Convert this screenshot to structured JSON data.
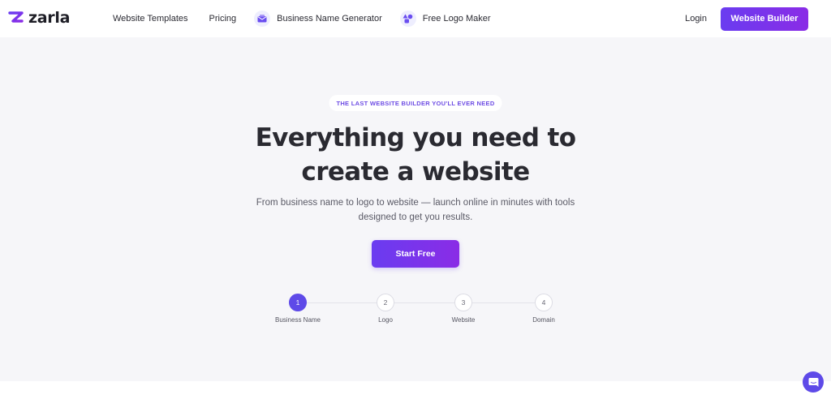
{
  "brand": {
    "name": "zarla",
    "color": "#5e4ae8"
  },
  "nav": {
    "links": [
      {
        "label": "Website Templates"
      },
      {
        "label": "Pricing"
      },
      {
        "label": "Business Name Generator",
        "icon": "envelope-icon"
      },
      {
        "label": "Free Logo Maker",
        "icon": "shapes-icon"
      }
    ],
    "login": "Login",
    "cta": "Website Builder"
  },
  "hero": {
    "badge": "THE LAST WEBSITE BUILDER YOU'LL EVER NEED",
    "headline_line1": "Everything you need to",
    "headline_line2": "create a website",
    "subtext_line1": "From business name to logo to website — launch online in minutes with tools",
    "subtext_line2": "designed to get you results.",
    "cta": "Start Free"
  },
  "stepper": {
    "steps": [
      {
        "number": "1",
        "label": "Business Name",
        "active": true
      },
      {
        "number": "2",
        "label": "Logo",
        "active": false
      },
      {
        "number": "3",
        "label": "Website",
        "active": false
      },
      {
        "number": "4",
        "label": "Domain",
        "active": false
      }
    ]
  },
  "chat": {
    "icon": "chat-bubble-icon"
  },
  "colors": {
    "accent": "#6a3cf0",
    "accent_gradient_end": "#8a2ce6",
    "hero_background": "#f6f6f9",
    "badge_text": "#6d4ce4"
  }
}
